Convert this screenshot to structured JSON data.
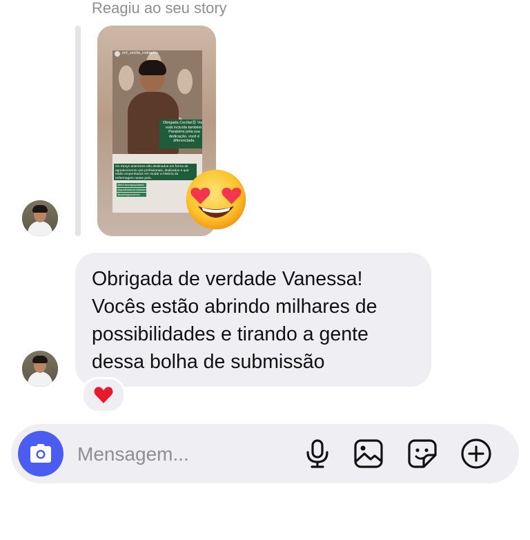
{
  "story_reply": {
    "caption": "Reagiu ao seu story",
    "story_preview": {
      "username": "enf_cecilia_rodrigues",
      "overlay_text_1": "Obrigada Cecília!😊 Você está incluída também. Parabéns pela sua dedicação, você é diferenciada.",
      "overlay_text_2": "Os Storys anteriores são destinados em forma de agradecimento aos profissionais, dedicados e que estão empenhados em mudar a história da enfermagem nesse país.",
      "tags": [
        "@enf.brunapupolardo",
        "@qualidadedevidalaser",
        "@cyntiagoncalves"
      ]
    },
    "reaction_emoji": "smiling-face-with-heart-eyes"
  },
  "message": {
    "text": "Obrigada de verdade Vanessa!\nVocês estão abrindo milhares de\npossibilidades e tirando a gente\ndessa bolha de submissão",
    "reaction": "red-heart"
  },
  "composer": {
    "placeholder": "Mensagem...",
    "icons": [
      "camera-icon",
      "microphone-icon",
      "gallery-icon",
      "sticker-icon",
      "add-icon"
    ]
  },
  "colors": {
    "bubble_bg": "#efeff3",
    "camera_btn": "#4b5cf0",
    "secondary_text": "#8e8e93"
  }
}
